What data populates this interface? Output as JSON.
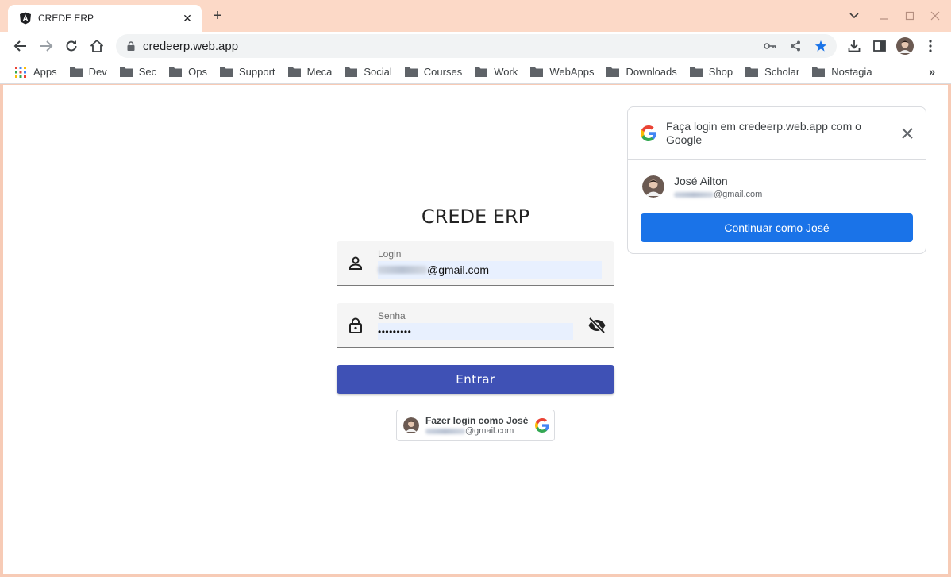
{
  "browser": {
    "tab_title": "CREDE ERP",
    "url": "credeerp.web.app",
    "bookmarks": [
      "Apps",
      "Dev",
      "Sec",
      "Ops",
      "Support",
      "Meca",
      "Social",
      "Courses",
      "Work",
      "WebApps",
      "Downloads",
      "Shop",
      "Scholar",
      "Nostagia"
    ],
    "more_bookmarks_icon": "chevron-double-right-icon"
  },
  "login": {
    "title": "CREDE ERP",
    "login_label": "Login",
    "login_value": "@gmail.com",
    "password_label": "Senha",
    "password_value": "•••••••••",
    "submit_label": "Entrar"
  },
  "gsi_button": {
    "name": "Fazer login como José",
    "email": "@gmail.com"
  },
  "one_tap": {
    "title": "Faça login em credeerp.web.app com o Google",
    "account_name": "José Ailton",
    "account_email": "@gmail.com",
    "continue_label": "Continuar como José"
  },
  "colors": {
    "primary": "#3f51b5",
    "google_blue": "#1a73e8",
    "frame": "#fcd9c7"
  }
}
